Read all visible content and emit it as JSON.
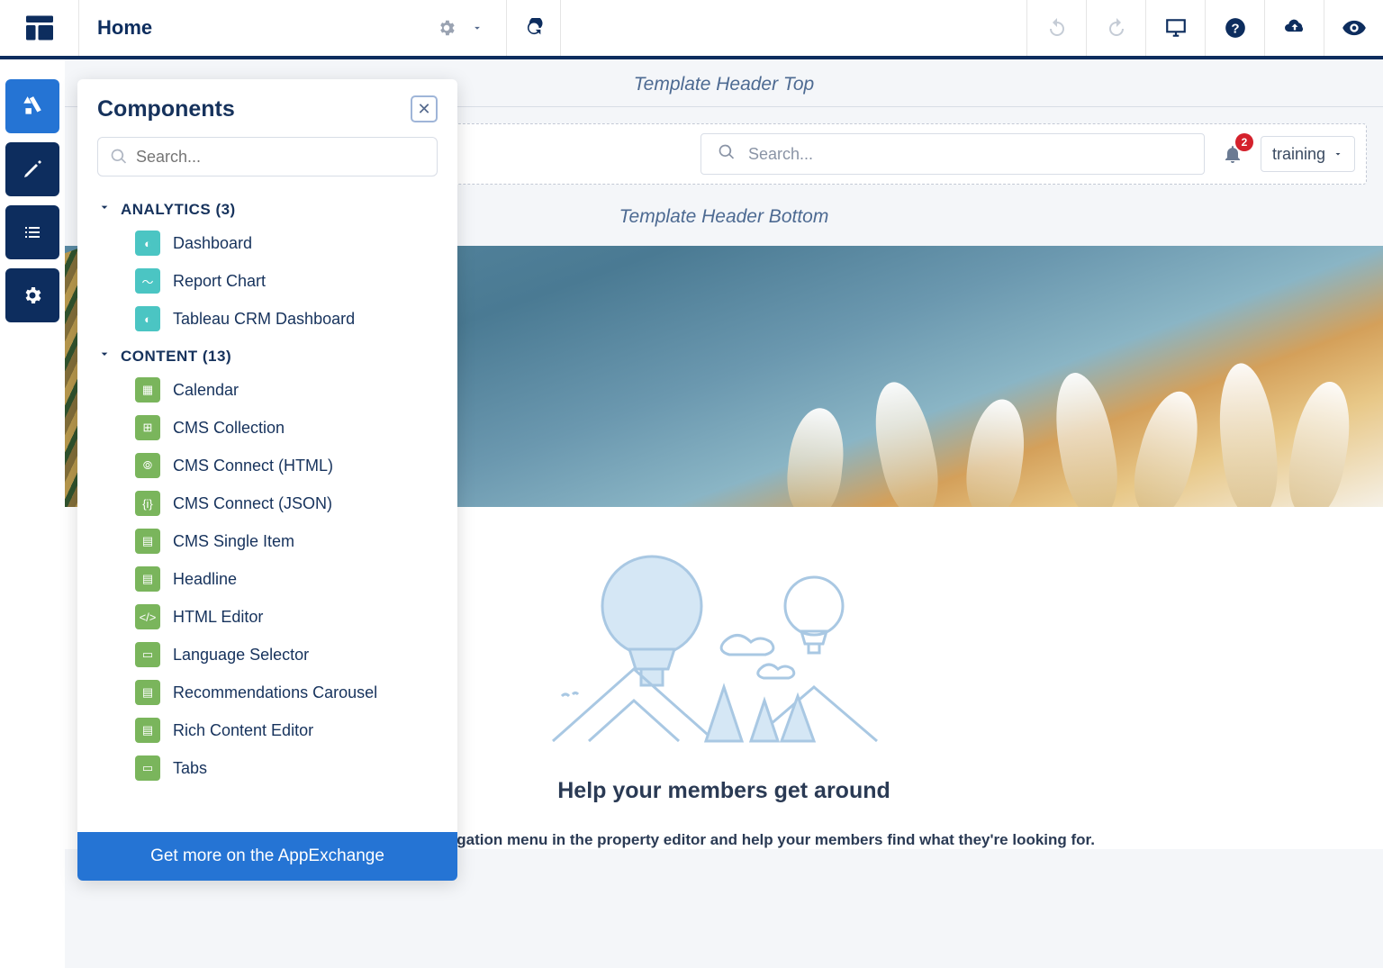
{
  "topbar": {
    "page_title": "Home"
  },
  "panel": {
    "title": "Components",
    "search_placeholder": "Search...",
    "footer": "Get more on the AppExchange",
    "groups": [
      {
        "title": "ANALYTICS (3)",
        "items": [
          {
            "label": "Dashboard",
            "color": "teal",
            "glyph": "◐"
          },
          {
            "label": "Report Chart",
            "color": "teal",
            "glyph": "〜"
          },
          {
            "label": "Tableau CRM Dashboard",
            "color": "teal",
            "glyph": "◐"
          }
        ]
      },
      {
        "title": "CONTENT (13)",
        "items": [
          {
            "label": "Calendar",
            "color": "green",
            "glyph": "▦"
          },
          {
            "label": "CMS Collection",
            "color": "green",
            "glyph": "⊞"
          },
          {
            "label": "CMS Connect (HTML)",
            "color": "green",
            "glyph": "⦾"
          },
          {
            "label": "CMS Connect (JSON)",
            "color": "green",
            "glyph": "{i}"
          },
          {
            "label": "CMS Single Item",
            "color": "green",
            "glyph": "▤"
          },
          {
            "label": "Headline",
            "color": "green",
            "glyph": "▤"
          },
          {
            "label": "HTML Editor",
            "color": "green",
            "glyph": "</>"
          },
          {
            "label": "Language Selector",
            "color": "green",
            "glyph": "▭"
          },
          {
            "label": "Recommendations Carousel",
            "color": "green",
            "glyph": "▤"
          },
          {
            "label": "Rich Content Editor",
            "color": "green",
            "glyph": "▤"
          },
          {
            "label": "Tabs",
            "color": "green",
            "glyph": "▭"
          }
        ]
      }
    ]
  },
  "canvas": {
    "template_header_top": "Template Header Top",
    "template_header_bottom": "Template Header Bottom",
    "search_placeholder": "Search...",
    "notification_count": "2",
    "profile_label": "training",
    "help_title": "Help your members get around",
    "help_sub": "Choose a navigation menu in the property editor and help your members find what they're looking for."
  }
}
